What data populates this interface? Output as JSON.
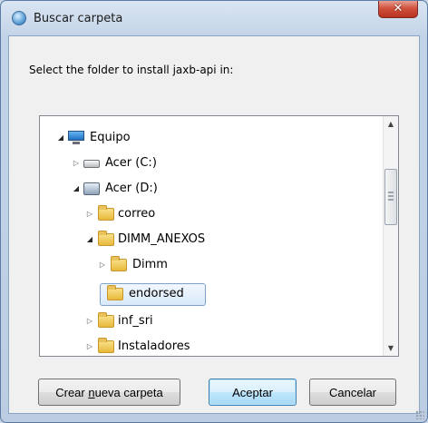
{
  "window": {
    "title": "Buscar carpeta",
    "close_label": "✕"
  },
  "dialog": {
    "prompt": "Select the folder to install jaxb-api in:"
  },
  "tree": {
    "items": [
      {
        "label": "Equipo",
        "icon": "computer-icon",
        "expanded": true
      },
      {
        "label": "Acer (C:)",
        "icon": "drive-icon",
        "expanded": false
      },
      {
        "label": "Acer (D:)",
        "icon": "drive-icon",
        "expanded": true
      },
      {
        "label": "correo",
        "icon": "folder-icon",
        "expanded": false
      },
      {
        "label": "DIMM_ANEXOS",
        "icon": "folder-icon",
        "expanded": true
      },
      {
        "label": "Dimm",
        "icon": "folder-icon",
        "expanded": false
      },
      {
        "label": "endorsed",
        "icon": "folder-icon",
        "selected": true
      },
      {
        "label": "inf_sri",
        "icon": "folder-icon",
        "expanded": false
      },
      {
        "label": "Instaladores",
        "icon": "folder-icon",
        "expanded": false
      }
    ]
  },
  "buttons": {
    "new_folder": "Crear nueva carpeta",
    "new_folder_accesskey": "n",
    "accept": "Aceptar",
    "cancel": "Cancelar"
  },
  "colors": {
    "selection_border": "#7da2ce",
    "default_button_border": "#3c7fb1",
    "close_button": "#c94a34"
  }
}
